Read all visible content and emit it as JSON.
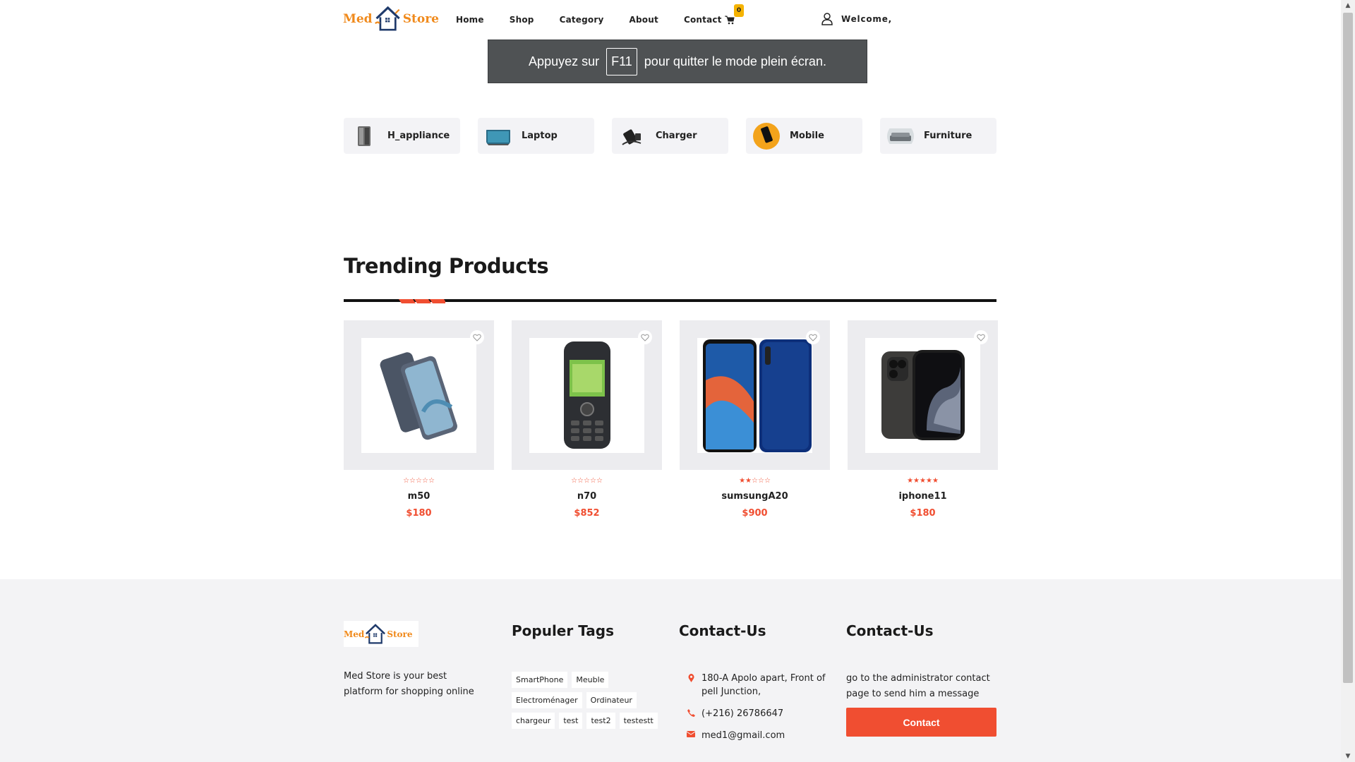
{
  "header": {
    "logo_left": "Med",
    "logo_right": "Store",
    "nav": [
      "Home",
      "Shop",
      "Category",
      "About",
      "Contact"
    ],
    "cart_count": "0",
    "welcome": "Welcome,"
  },
  "toast": {
    "before": "Appuyez sur",
    "key": "F11",
    "after": "pour quitter le mode plein écran."
  },
  "categories": [
    {
      "label": "H_appliance",
      "icon": "fridge-icon"
    },
    {
      "label": "Laptop",
      "icon": "laptop-icon"
    },
    {
      "label": "Charger",
      "icon": "charger-icon"
    },
    {
      "label": "Mobile",
      "icon": "mobile-icon"
    },
    {
      "label": "Furniture",
      "icon": "furniture-icon"
    }
  ],
  "trending": {
    "title": "Trending Products",
    "accent_color": "#f04e31",
    "products": [
      {
        "name": "m50",
        "price": "$180",
        "rating": 0
      },
      {
        "name": "n70",
        "price": "$852",
        "rating": 0
      },
      {
        "name": "sumsungA20",
        "price": "$900",
        "rating": 2
      },
      {
        "name": "iphone11",
        "price": "$180",
        "rating": 5
      }
    ]
  },
  "footer": {
    "logo_left": "Med",
    "logo_right": "Store",
    "description": "Med Store is your best platform for shopping online",
    "tags_title": "Populer Tags",
    "tags": [
      "SmartPhone",
      "Meuble",
      "Electroménager",
      "Ordinateur",
      "chargeur",
      "test",
      "test2",
      "testestt"
    ],
    "contact_title": "Contact-Us",
    "address": "180-A Apolo apart, Front of pell Junction,",
    "phone": "(+216) 26786647",
    "email": "med1@gmail.com",
    "contact2_title": "Contact-Us",
    "message": "go to the administrator contact page to send him a message",
    "contact_button": "Contact"
  }
}
